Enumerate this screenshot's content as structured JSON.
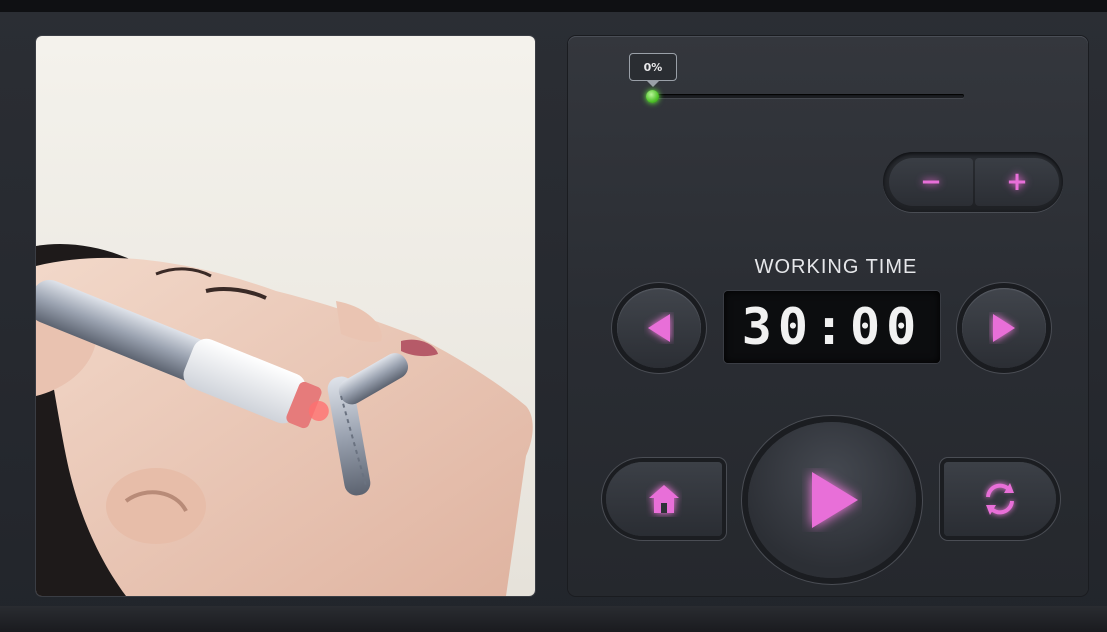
{
  "progress": {
    "label": "0%",
    "value": 0
  },
  "controls": {
    "decrease_label": "−",
    "increase_label": "+",
    "working_time_label": "WORKING TIME",
    "working_time_value": "30:00"
  },
  "icons": {
    "left": "triangle-left-icon",
    "right": "triangle-right-icon",
    "play": "play-icon",
    "home": "home-icon",
    "reset": "refresh-icon"
  },
  "colors": {
    "accent": "#e86fd8",
    "progress": "#6cd84a",
    "display_bg": "#0c0d0f"
  }
}
